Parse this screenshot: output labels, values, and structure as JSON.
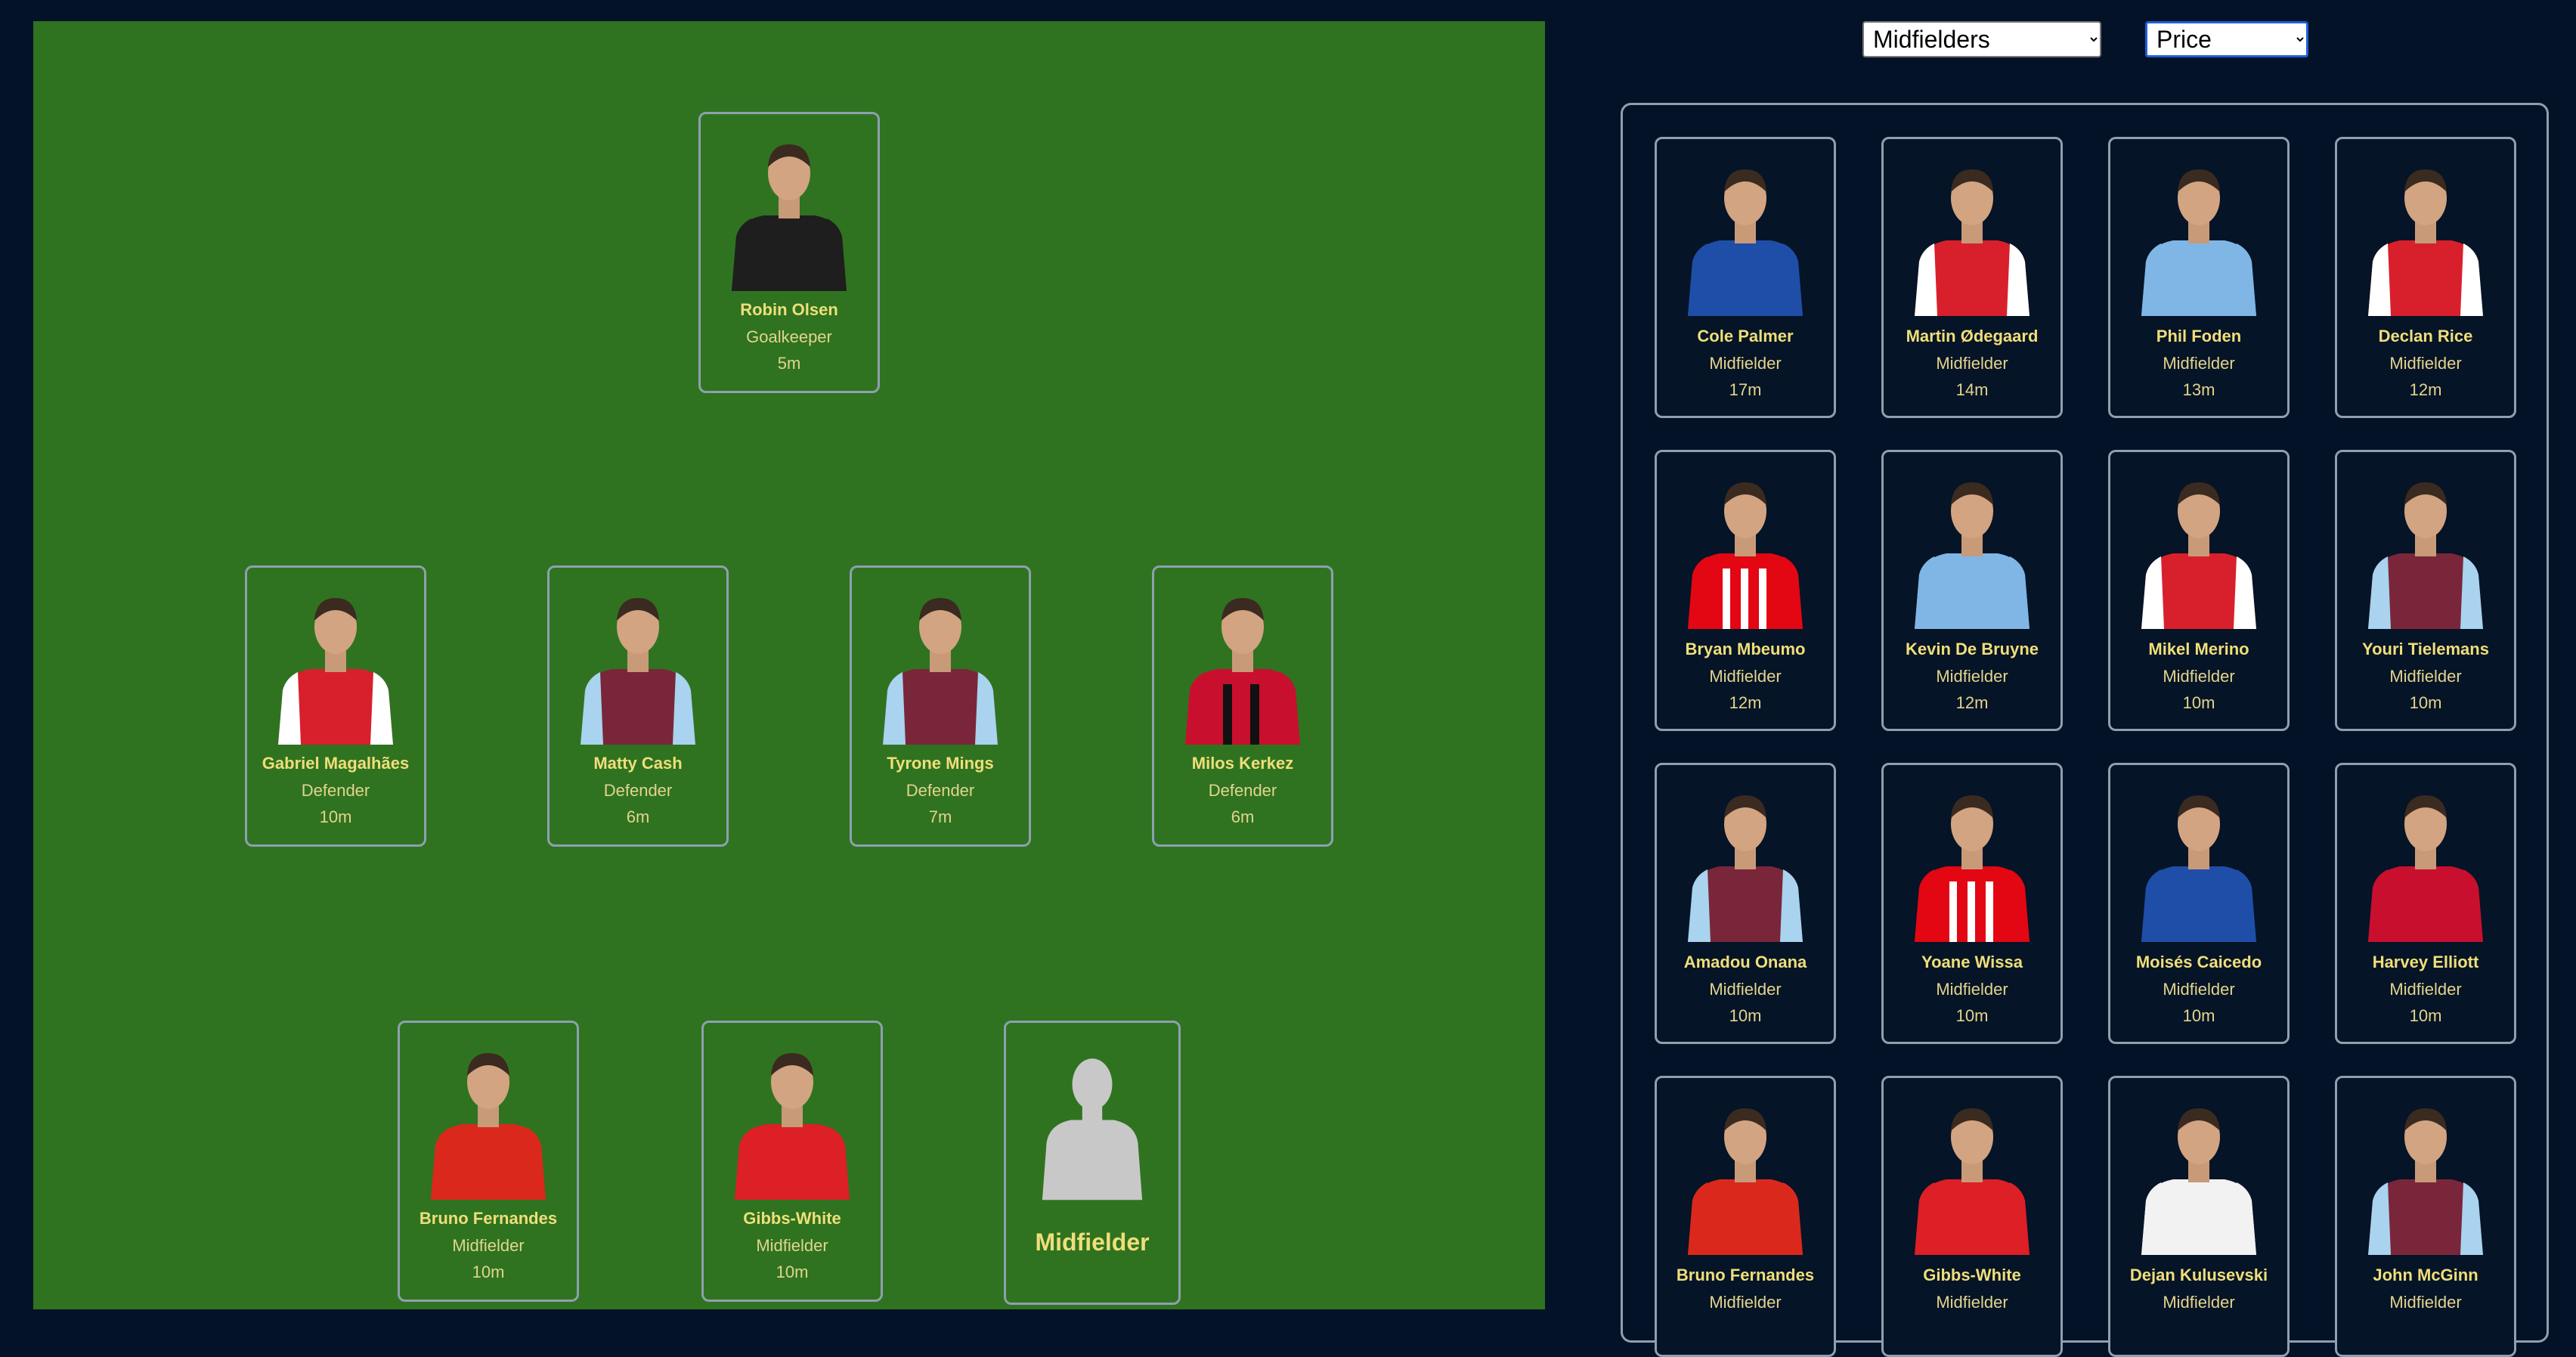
{
  "filters": {
    "position_selected": "Midfielders",
    "sort_selected": "Price"
  },
  "pitch": {
    "goalkeeper": {
      "name": "Robin Olsen",
      "role": "Goalkeeper",
      "price": "5m",
      "kit": "keeper-black"
    },
    "defenders": [
      {
        "name": "Gabriel Magalhães",
        "role": "Defender",
        "price": "10m",
        "kit": "arsenal"
      },
      {
        "name": "Matty Cash",
        "role": "Defender",
        "price": "6m",
        "kit": "villa"
      },
      {
        "name": "Tyrone Mings",
        "role": "Defender",
        "price": "7m",
        "kit": "villa"
      },
      {
        "name": "Milos Kerkez",
        "role": "Defender",
        "price": "6m",
        "kit": "bournemouth"
      }
    ],
    "midfielders": [
      {
        "name": "Bruno Fernandes",
        "role": "Midfielder",
        "price": "10m",
        "kit": "united"
      },
      {
        "name": "Gibbs-White",
        "role": "Midfielder",
        "price": "10m",
        "kit": "forest"
      }
    ],
    "empty_slot": {
      "label": "Midfielder",
      "icon": "silhouette-icon"
    }
  },
  "player_list": [
    {
      "name": "Cole Palmer",
      "role": "Midfielder",
      "price": "17m",
      "kit": "chelsea"
    },
    {
      "name": "Martin Ødegaard",
      "role": "Midfielder",
      "price": "14m",
      "kit": "arsenal"
    },
    {
      "name": "Phil Foden",
      "role": "Midfielder",
      "price": "13m",
      "kit": "city"
    },
    {
      "name": "Declan Rice",
      "role": "Midfielder",
      "price": "12m",
      "kit": "arsenal"
    },
    {
      "name": "Bryan Mbeumo",
      "role": "Midfielder",
      "price": "12m",
      "kit": "brentford"
    },
    {
      "name": "Kevin De Bruyne",
      "role": "Midfielder",
      "price": "12m",
      "kit": "city"
    },
    {
      "name": "Mikel Merino",
      "role": "Midfielder",
      "price": "10m",
      "kit": "arsenal"
    },
    {
      "name": "Youri Tielemans",
      "role": "Midfielder",
      "price": "10m",
      "kit": "villa"
    },
    {
      "name": "Amadou Onana",
      "role": "Midfielder",
      "price": "10m",
      "kit": "villa"
    },
    {
      "name": "Yoane Wissa",
      "role": "Midfielder",
      "price": "10m",
      "kit": "brentford"
    },
    {
      "name": "Moisés Caicedo",
      "role": "Midfielder",
      "price": "10m",
      "kit": "chelsea"
    },
    {
      "name": "Harvey Elliott",
      "role": "Midfielder",
      "price": "10m",
      "kit": "liverpool"
    },
    {
      "name": "Bruno Fernandes",
      "role": "Midfielder",
      "price": "",
      "kit": "united"
    },
    {
      "name": "Gibbs-White",
      "role": "Midfielder",
      "price": "",
      "kit": "forest"
    },
    {
      "name": "Dejan Kulusevski",
      "role": "Midfielder",
      "price": "",
      "kit": "spurs"
    },
    {
      "name": "John McGinn",
      "role": "Midfielder",
      "price": "",
      "kit": "villa"
    }
  ],
  "kit_colors": {
    "arsenal": "#d8202c",
    "villa": "#7a263a",
    "bournemouth": "#c8102e",
    "united": "#da291c",
    "forest": "#dd1f26",
    "chelsea": "#1f4ea8",
    "city": "#7fb6e6",
    "brentford": "#e30613",
    "liverpool": "#c8102e",
    "spurs": "#f2f2f2",
    "keeper-black": "#1e1e1e"
  }
}
